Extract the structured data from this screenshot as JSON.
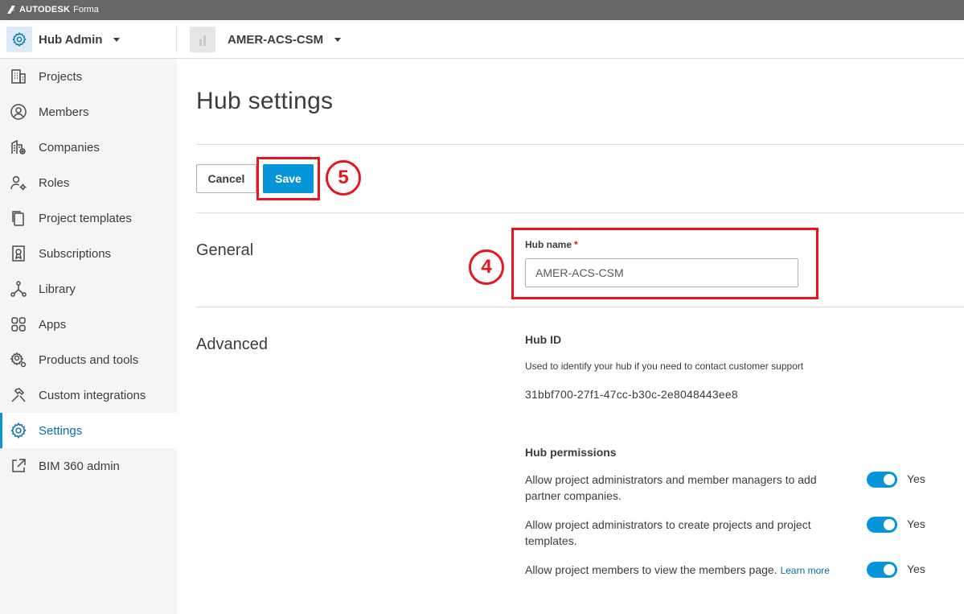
{
  "brand": {
    "company": "AUTODESK",
    "product": "Forma"
  },
  "header": {
    "module": "Hub Admin",
    "hub": "AMER-ACS-CSM"
  },
  "sidebar": {
    "items": [
      {
        "label": "Projects",
        "icon": "building-icon"
      },
      {
        "label": "Members",
        "icon": "user-circle-icon"
      },
      {
        "label": "Companies",
        "icon": "company-icon"
      },
      {
        "label": "Roles",
        "icon": "user-gear-icon"
      },
      {
        "label": "Project templates",
        "icon": "templates-icon"
      },
      {
        "label": "Subscriptions",
        "icon": "subscription-icon"
      },
      {
        "label": "Library",
        "icon": "library-icon"
      },
      {
        "label": "Apps",
        "icon": "apps-grid-icon"
      },
      {
        "label": "Products and tools",
        "icon": "products-gear-icon"
      },
      {
        "label": "Custom integrations",
        "icon": "hammer-icon"
      },
      {
        "label": "Settings",
        "icon": "gear-icon",
        "active": true
      },
      {
        "label": "BIM 360 admin",
        "icon": "external-link-icon"
      }
    ]
  },
  "main": {
    "title": "Hub settings",
    "cancel_label": "Cancel",
    "save_label": "Save",
    "callouts": {
      "save": "5",
      "hub_name": "4"
    },
    "general": {
      "title": "General",
      "hub_name_label": "Hub name",
      "required_mark": "*",
      "hub_name_value": "AMER-ACS-CSM"
    },
    "advanced": {
      "title": "Advanced",
      "hub_id_heading": "Hub ID",
      "hub_id_desc": "Used to identify your hub if you need to contact customer support",
      "hub_id_value": "31bbf700-27f1-47cc-b30c-2e8048443ee8",
      "permissions_heading": "Hub permissions",
      "permissions": [
        {
          "text": "Allow project administrators and member managers to add partner companies.",
          "state": "Yes",
          "on": true
        },
        {
          "text": "Allow project administrators to create projects and project templates.",
          "state": "Yes",
          "on": true
        },
        {
          "text": "Allow project members to view the members page.",
          "link": "Learn more",
          "state": "Yes",
          "on": true
        }
      ]
    }
  },
  "colors": {
    "accent": "#0696d7",
    "callout": "#e8141e",
    "sidebar_bg": "#f5f5f5",
    "brandbar": "#666666"
  }
}
